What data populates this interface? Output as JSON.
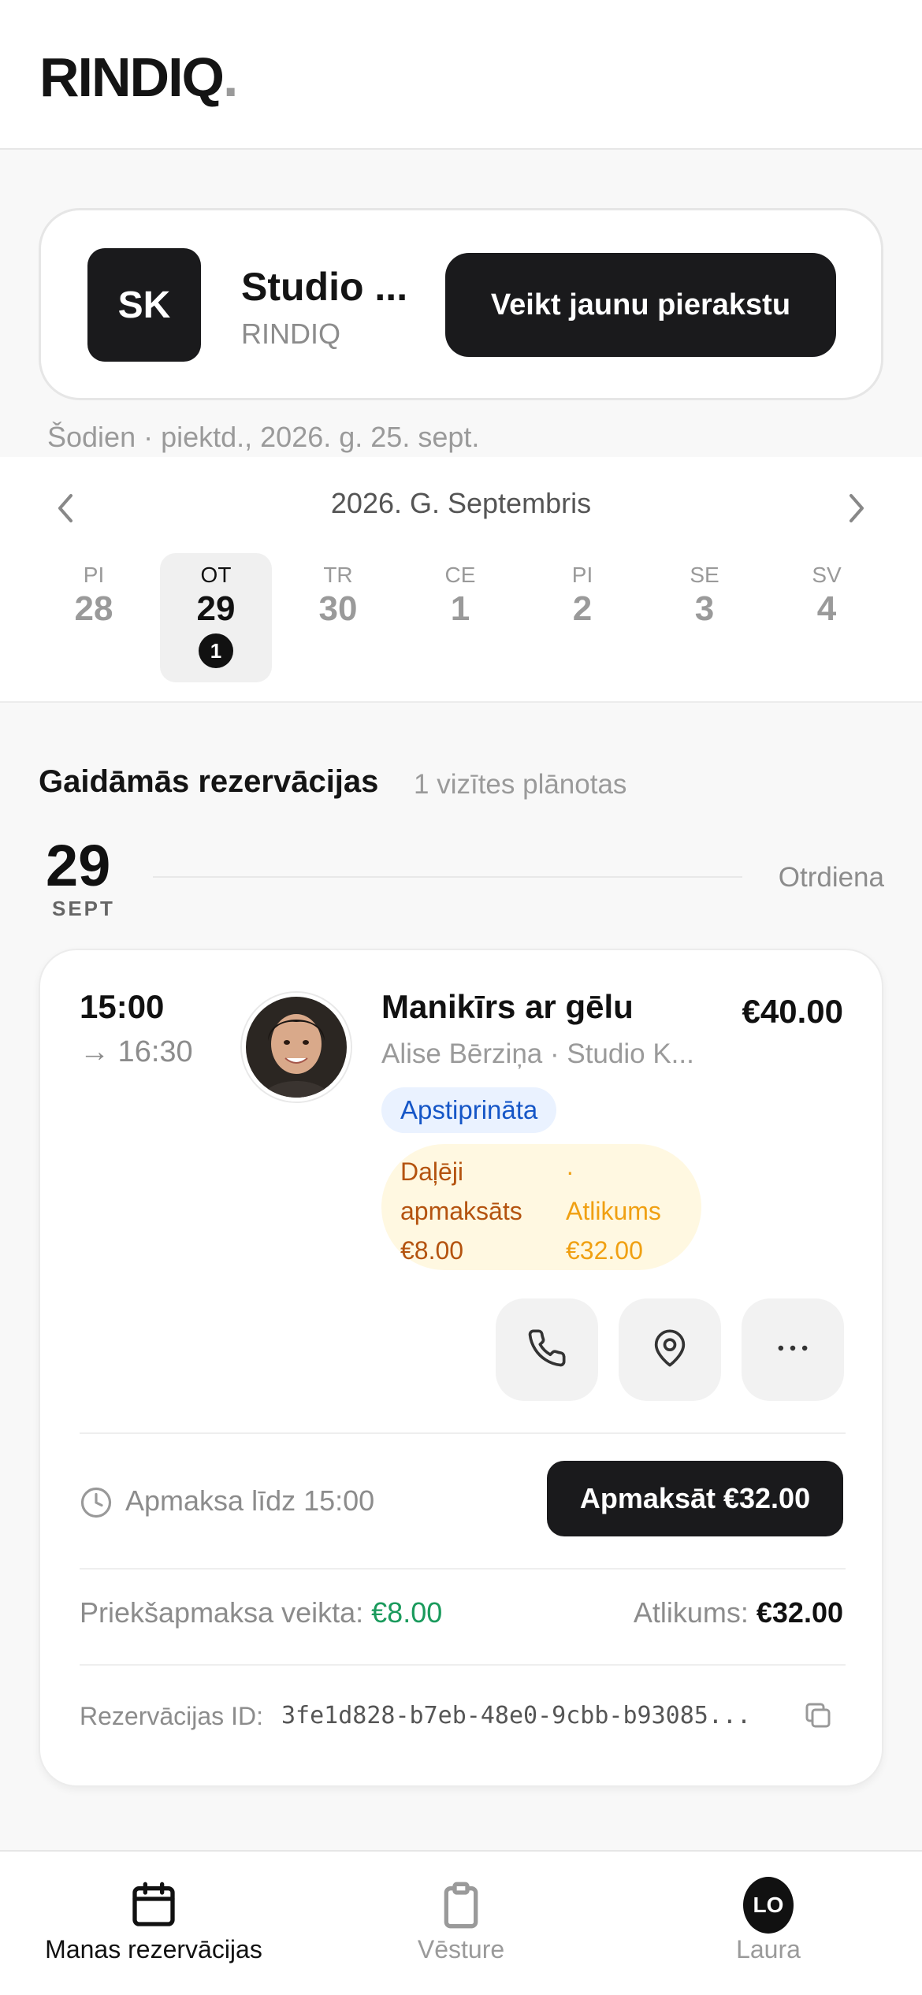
{
  "header": {
    "logo_text": "RINDIQ",
    "logo_dot": "."
  },
  "salon": {
    "initials": "SK",
    "name": "Studio ...",
    "brand": "RINDIQ",
    "new_booking_label": "Veikt jaunu pierakstu"
  },
  "today_label": "Šodien · piektd., 2026. g. 25. sept.",
  "calendar": {
    "month_label": "2026. G. Septembris",
    "days": [
      {
        "name": "PI",
        "num": "28",
        "count": ""
      },
      {
        "name": "OT",
        "num": "29",
        "count": "1",
        "selected": true
      },
      {
        "name": "TR",
        "num": "30",
        "count": ""
      },
      {
        "name": "CE",
        "num": "1",
        "count": ""
      },
      {
        "name": "PI",
        "num": "2",
        "count": ""
      },
      {
        "name": "SE",
        "num": "3",
        "count": ""
      },
      {
        "name": "SV",
        "num": "4",
        "count": ""
      }
    ]
  },
  "upcoming": {
    "title": "Gaidāmās rezervācijas",
    "subtitle": "1 vizītes plānotas",
    "date_num": "29",
    "date_month": "SEPT",
    "weekday": "Otrdiena"
  },
  "booking": {
    "start": "15:00",
    "end": "→ 16:30",
    "service": "Manikīrs ar gēlu",
    "price": "€40.00",
    "staff_line": "Alise Bērziņa · Studio K...",
    "status": "Apstiprināta",
    "payment": {
      "left_line1": "Daļēji",
      "left_line2": "apmaksāts",
      "left_line3": "€8.00",
      "right_line1": "·",
      "right_line2": "Atlikums",
      "right_line3": "€32.00"
    },
    "due_text": "Apmaksa līdz 15:00",
    "pay_button": "Apmaksāt €32.00",
    "prepaid_label": "Priekšapmaksa veikta:",
    "prepaid_value": "€8.00",
    "remaining_label": "Atlikums:",
    "remaining_value": "€32.00",
    "id_label": "Rezervācijas ID:",
    "id_value": "3fe1d828-b7eb-48e0-9cbb-b93085..."
  },
  "nav": {
    "bookings": "Manas rezervācijas",
    "history": "Vēsture",
    "profile": "Laura",
    "profile_initials": "LO"
  },
  "colors": {
    "primary": "#1a1a1c",
    "status_blue": "#1556c7",
    "status_bg": "#eaf2ff",
    "paid_green": "#1a9a5c",
    "partial_orange": "#b4530f",
    "remaining_amber": "#f0a012"
  },
  "icons": [
    "chevron-left-icon",
    "chevron-right-icon",
    "phone-icon",
    "location-pin-icon",
    "more-icon",
    "clock-icon",
    "copy-icon",
    "calendar-icon",
    "clipboard-icon"
  ]
}
